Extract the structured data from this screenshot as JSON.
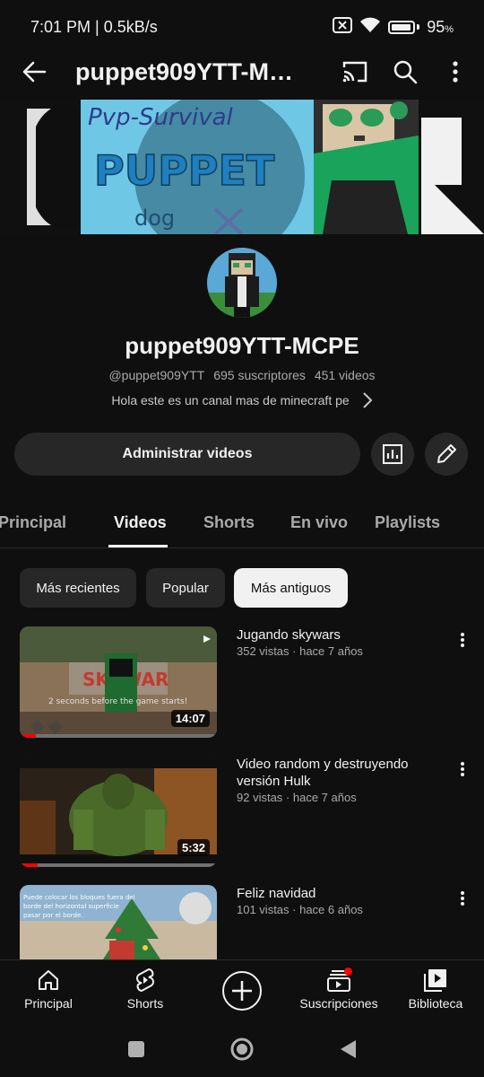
{
  "status_bar": {
    "time_speed": "7:01 PM | 0.5kB/s",
    "battery": "95"
  },
  "app_bar": {
    "title": "puppet909YTT-MC…"
  },
  "channel": {
    "name": "puppet909YTT-MCPE",
    "handle": "@puppet909YTT",
    "subscribers": "695 suscriptores",
    "video_count": "451 videos",
    "description": "Hola este es un canal mas de minecraft pe"
  },
  "actions": {
    "manage_label": "Administrar videos"
  },
  "tabs": [
    {
      "label": "Principal"
    },
    {
      "label": "Videos"
    },
    {
      "label": "Shorts"
    },
    {
      "label": "En vivo"
    },
    {
      "label": "Playlists"
    }
  ],
  "chips": [
    {
      "label": "Más recientes"
    },
    {
      "label": "Popular"
    },
    {
      "label": "Más antiguos"
    }
  ],
  "videos": [
    {
      "title": "Jugando skywars",
      "meta": "352 vistas · hace 7 años",
      "duration": "14:07",
      "progress": 0.08
    },
    {
      "title": "Video random y destruyendo versión Hulk",
      "meta": "92 vistas · hace 7 años",
      "duration": "5:32",
      "progress": 0.09
    },
    {
      "title": "Feliz navidad",
      "meta": "101 vistas · hace 6 años",
      "duration": "",
      "progress": 0
    }
  ],
  "bottom_nav": [
    {
      "label": "Principal",
      "icon": "home-icon"
    },
    {
      "label": "Shorts",
      "icon": "shorts-icon"
    },
    {
      "label": "",
      "icon": "create-icon"
    },
    {
      "label": "Suscripciones",
      "icon": "subscriptions-icon"
    },
    {
      "label": "Biblioteca",
      "icon": "library-icon"
    }
  ],
  "colors": {
    "background": "#0f0f0f",
    "surface": "#272727",
    "text": "#f1f1f1",
    "secondary_text": "#aaaaaa",
    "accent_red": "#ff0000"
  }
}
